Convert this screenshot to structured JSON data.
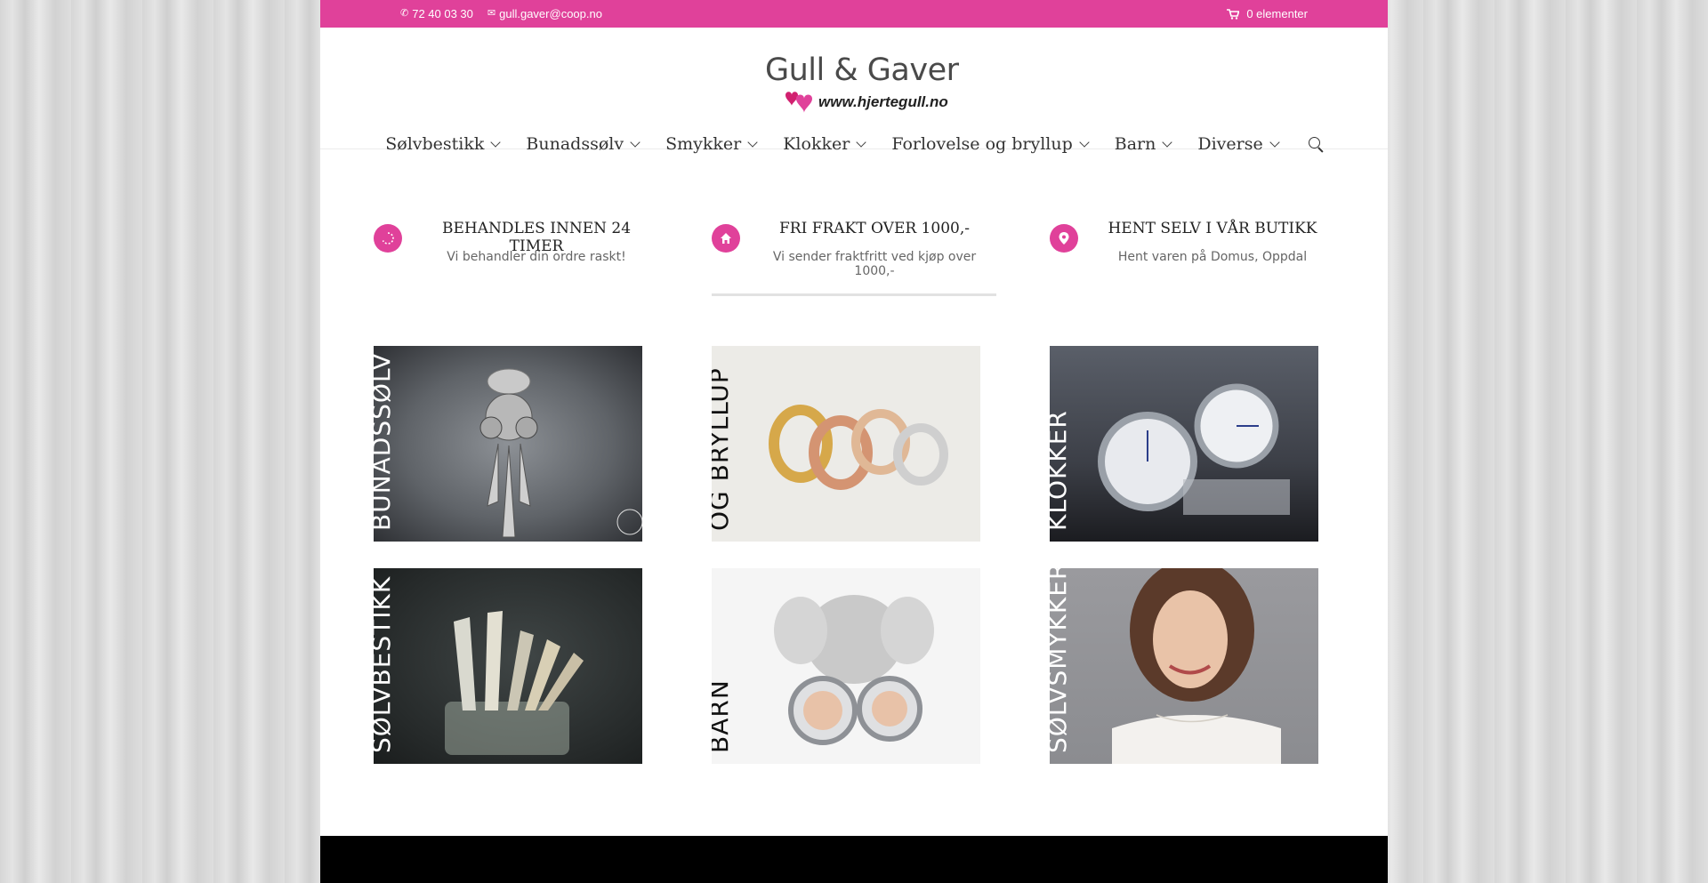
{
  "topbar": {
    "phone": "72 40 03 30",
    "email": "gull.gaver@coop.no",
    "cart": "0 elementer",
    "phone_icon": "phone-icon",
    "email_icon": "envelope-icon",
    "cart_icon": "cart-icon"
  },
  "logo": {
    "title": "Gull & Gaver",
    "url": "www.hjertegull.no"
  },
  "nav": {
    "items": [
      {
        "label": "Sølvbestikk"
      },
      {
        "label": "Bunadssølv"
      },
      {
        "label": "Smykker"
      },
      {
        "label": "Klokker"
      },
      {
        "label": "Forlovelse og bryllup"
      },
      {
        "label": "Barn"
      },
      {
        "label": "Diverse"
      }
    ],
    "search_icon": "search-icon"
  },
  "features": [
    {
      "title": "BEHANDLES INNEN 24 TIMER",
      "text": "Vi behandler din ordre raskt!",
      "icon": "spinner-icon"
    },
    {
      "title": "FRI FRAKT OVER 1000,-",
      "text": "Vi sender fraktfritt ved kjøp over 1000,-",
      "icon": "home-icon"
    },
    {
      "title": "HENT SELV I VÅR BUTIKK",
      "text": "Hent varen på Domus, Oppdal",
      "icon": "location-pin-icon"
    }
  ],
  "tiles": [
    {
      "label": "BUNADSSØLV"
    },
    {
      "label": "FORLOVELSE\nOG BRYLLUP"
    },
    {
      "label": "KLOKKER"
    },
    {
      "label": "SØLVBESTIKK"
    },
    {
      "label": "BARN"
    },
    {
      "label": "SØLVSMYKKER"
    }
  ],
  "colors": {
    "accent": "#e0419a",
    "footer": "#000000"
  }
}
